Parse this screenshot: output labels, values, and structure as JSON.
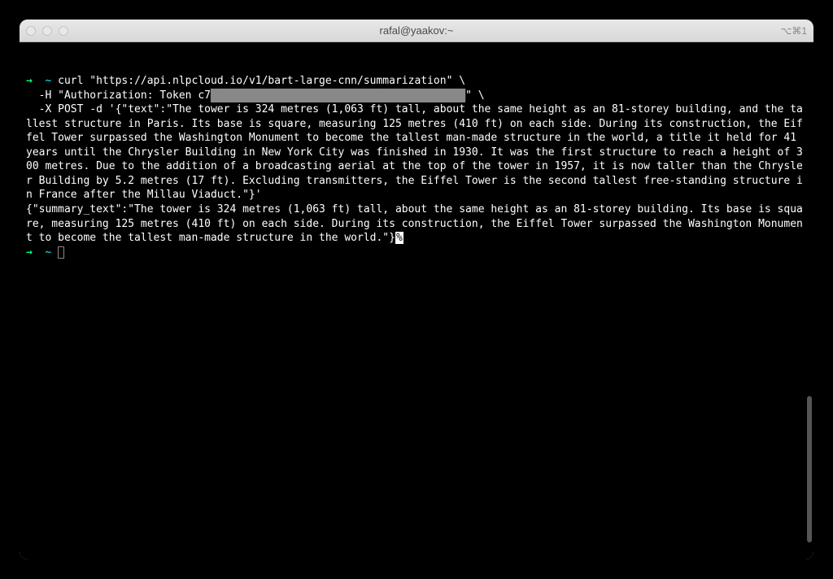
{
  "window": {
    "title": "rafal@yaakov:~",
    "shortcut_indicator": "⌘1",
    "alt_icon": "⌥"
  },
  "prompt": {
    "arrow": "→",
    "path": "~"
  },
  "command": {
    "curl_prefix": "curl \"",
    "url": "https://api.nlpcloud.io/v1/bart-large-cnn/summarization",
    "curl_suffix": "\" \\",
    "header_prefix": "  -H \"Authorization: Token c7",
    "redacted_token": "████████████████████████████████████████",
    "header_suffix": "\" \\",
    "post_body": "  -X POST -d '{\"text\":\"The tower is 324 metres (1,063 ft) tall, about the same height as an 81-storey building, and the tallest structure in Paris. Its base is square, measuring 125 metres (410 ft) on each side. During its construction, the Eiffel Tower surpassed the Washington Monument to become the tallest man-made structure in the world, a title it held for 41 years until the Chrysler Building in New York City was finished in 1930. It was the first structure to reach a height of 300 metres. Due to the addition of a broadcasting aerial at the top of the tower in 1957, it is now taller than the Chrysler Building by 5.2 metres (17 ft). Excluding transmitters, the Eiffel Tower is the second tallest free-standing structure in France after the Millau Viaduct.\"}'"
  },
  "response": {
    "text": "{\"summary_text\":\"The tower is 324 metres (1,063 ft) tall, about the same height as an 81-storey building. Its base is square, measuring 125 metres (410 ft) on each side. During its construction, the Eiffel Tower surpassed the Washington Monument to become the tallest man-made structure in the world.\"}",
    "eol_marker": "%"
  }
}
